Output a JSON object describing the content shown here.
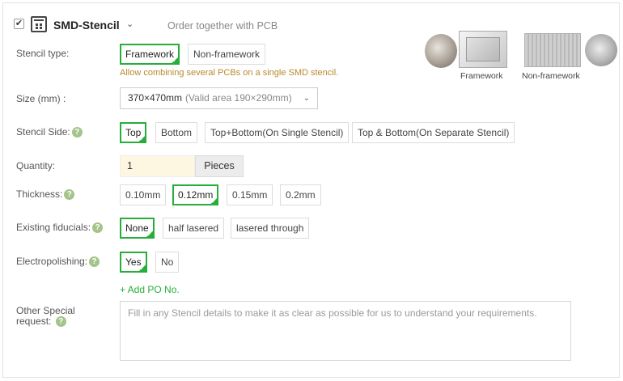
{
  "header": {
    "checkbox_checked": true,
    "title": "SMD-Stencil",
    "subtitle": "Order together with PCB"
  },
  "stencil_type": {
    "label": "Stencil type:",
    "options": [
      "Framework",
      "Non-framework"
    ],
    "selected": "Framework",
    "hint": "Allow combining several PCBs on a single SMD stencil.",
    "thumbnails": {
      "framework_caption": "Framework",
      "non_framework_caption": "Non-framework"
    }
  },
  "size": {
    "label": "Size (mm) :",
    "value": "370×470mm",
    "valid_area": "(Valid area 190×290mm)"
  },
  "stencil_side": {
    "label": "Stencil Side:",
    "options": [
      "Top",
      "Bottom",
      "Top+Bottom(On Single Stencil)",
      "Top & Bottom(On Separate Stencil)"
    ],
    "selected": "Top"
  },
  "quantity": {
    "label": "Quantity:",
    "value": "1",
    "unit": "Pieces"
  },
  "thickness": {
    "label": "Thickness:",
    "options": [
      "0.10mm",
      "0.12mm",
      "0.15mm",
      "0.2mm"
    ],
    "selected": "0.12mm"
  },
  "fiducials": {
    "label": "Existing fiducials:",
    "options": [
      "None",
      "half lasered",
      "lasered through"
    ],
    "selected": "None"
  },
  "electropolishing": {
    "label": "Electropolishing:",
    "options": [
      "Yes",
      "No"
    ],
    "selected": "Yes"
  },
  "add_po": "+ Add PO No.",
  "special_request": {
    "label_line1": "Other Special",
    "label_line2": "request:",
    "placeholder": "Fill in any Stencil details to make it as clear as possible for us to understand your requirements."
  },
  "colors": {
    "accent": "#27ae3a",
    "hint": "#b88a2c",
    "help_icon": "#a3c48a"
  }
}
